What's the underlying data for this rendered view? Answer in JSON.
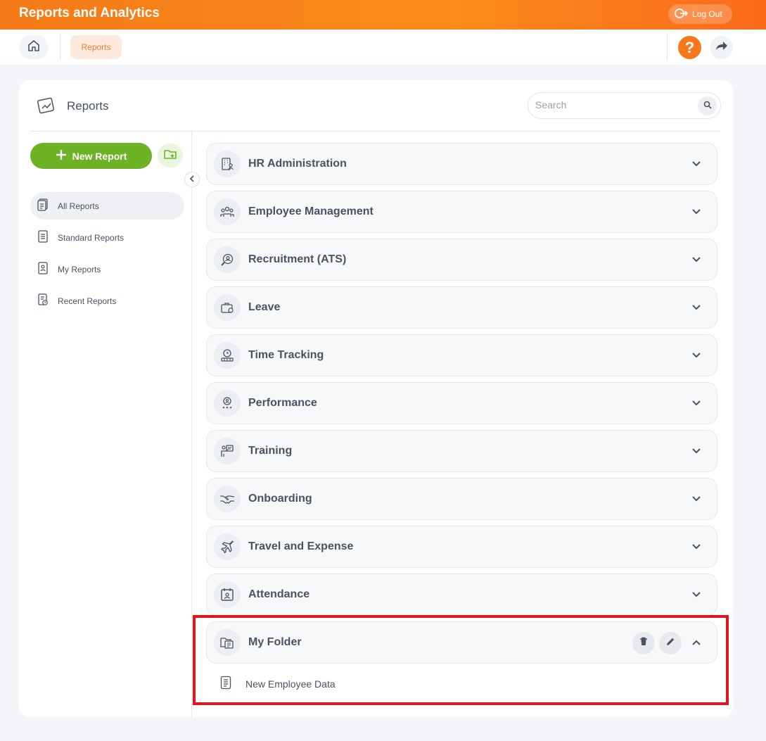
{
  "header": {
    "title": "Reports and Analytics",
    "logout_label": "Log Out"
  },
  "breadcrumb": {
    "current": "Reports"
  },
  "help_label": "?",
  "card": {
    "title": "Reports"
  },
  "search": {
    "placeholder": "Search"
  },
  "sidebar": {
    "new_report_label": "New Report",
    "items": [
      {
        "label": "All Reports",
        "icon": "all-reports-icon",
        "active": true
      },
      {
        "label": "Standard Reports",
        "icon": "standard-reports-icon"
      },
      {
        "label": "My Reports",
        "icon": "my-reports-icon"
      },
      {
        "label": "Recent Reports",
        "icon": "recent-reports-icon"
      }
    ]
  },
  "categories": [
    {
      "label": "HR Administration",
      "icon": "building-icon"
    },
    {
      "label": "Employee Management",
      "icon": "people-icon"
    },
    {
      "label": "Recruitment (ATS)",
      "icon": "search-person-icon"
    },
    {
      "label": "Leave",
      "icon": "briefcase-icon"
    },
    {
      "label": "Time Tracking",
      "icon": "clock-icon"
    },
    {
      "label": "Performance",
      "icon": "award-icon"
    },
    {
      "label": "Training",
      "icon": "presentation-icon"
    },
    {
      "label": "Onboarding",
      "icon": "handshake-icon"
    },
    {
      "label": "Travel and Expense",
      "icon": "airplane-icon"
    },
    {
      "label": "Attendance",
      "icon": "calendar-icon"
    }
  ],
  "my_folder": {
    "label": "My Folder",
    "icon": "folder-icon",
    "expanded": true,
    "items": [
      {
        "label": "New Employee Data",
        "icon": "document-icon"
      }
    ]
  },
  "colors": {
    "accent": "#f7781b",
    "primary_green": "#6db125",
    "highlight_red": "#e0161e"
  }
}
